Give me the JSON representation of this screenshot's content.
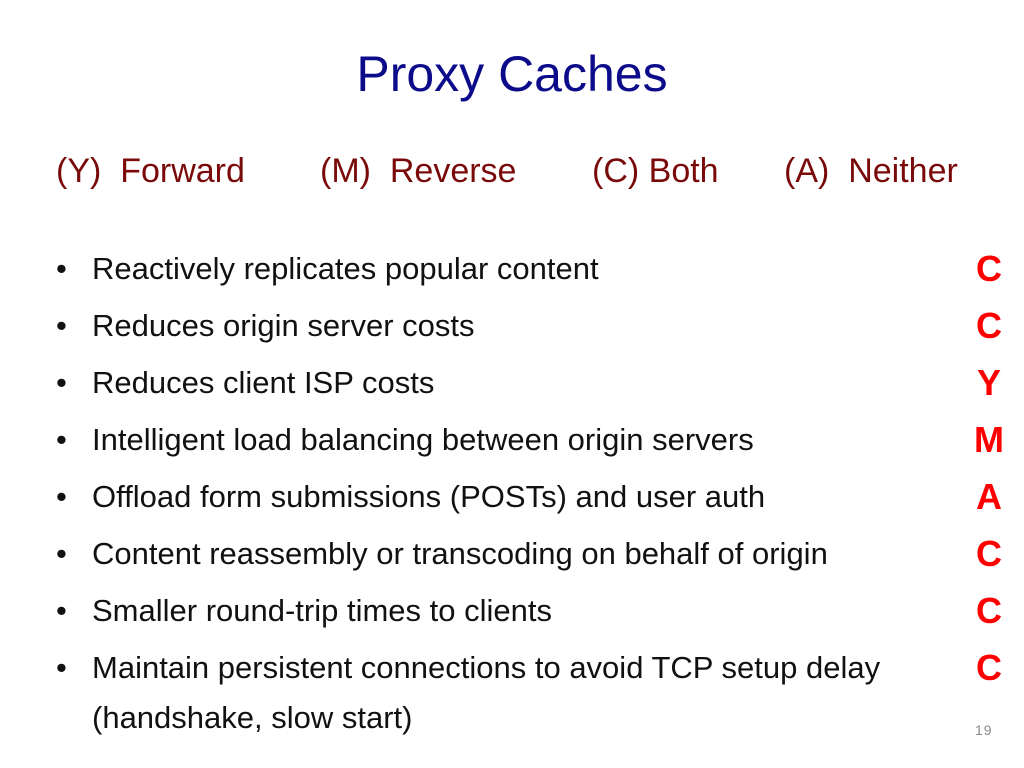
{
  "slide": {
    "title": "Proxy Caches",
    "options": [
      {
        "label": "(Y)  Forward"
      },
      {
        "label": "(M)  Reverse"
      },
      {
        "label": "(C) Both"
      },
      {
        "label": "(A)  Neither"
      }
    ],
    "items": [
      {
        "text": "Reactively replicates popular content",
        "answer": "C"
      },
      {
        "text": "Reduces origin server costs",
        "answer": "C"
      },
      {
        "text": "Reduces client ISP costs",
        "answer": "Y"
      },
      {
        "text": "Intelligent load balancing between origin servers",
        "answer": "M"
      },
      {
        "text": "Offload form submissions (POSTs) and user auth",
        "answer": "A"
      },
      {
        "text": "Content reassembly or transcoding on behalf of origin",
        "answer": "C"
      },
      {
        "text": "Smaller round-trip times to clients",
        "answer": "C"
      },
      {
        "text": "Maintain persistent connections to avoid TCP setup delay (handshake, slow start)",
        "answer": "C"
      }
    ],
    "bullet_glyph": "•",
    "page_number": "19",
    "colors": {
      "title": "#0c0c8a",
      "options": "#7a0a0a",
      "answers": "#ff0000",
      "body_text": "#111111",
      "page_number": "#8a8a8a"
    }
  }
}
